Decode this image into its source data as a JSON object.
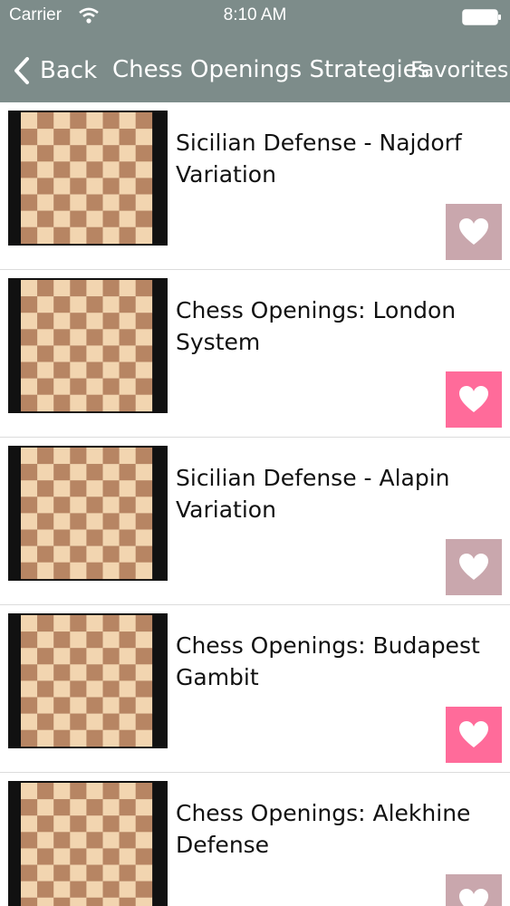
{
  "status_bar": {
    "carrier": "Carrier",
    "time": "8:10 AM"
  },
  "nav": {
    "back_label": "Back",
    "title": "Chess Openings Strategies",
    "favorites_label": "Favorites"
  },
  "items": [
    {
      "title": "Sicilian Defense - Najdorf Variation",
      "favorited": false
    },
    {
      "title": "Chess Openings: London System",
      "favorited": true
    },
    {
      "title": "Sicilian Defense - Alapin Variation",
      "favorited": false
    },
    {
      "title": "Chess Openings: Budapest Gambit",
      "favorited": true
    },
    {
      "title": "Chess Openings:  Alekhine Defense",
      "favorited": false
    }
  ],
  "colors": {
    "navbar": "#7d8c8a",
    "fav_on": "#ff6b9a",
    "fav_off": "#c9a7ad",
    "light_square": "#f2d5b0",
    "dark_square": "#b78563"
  }
}
